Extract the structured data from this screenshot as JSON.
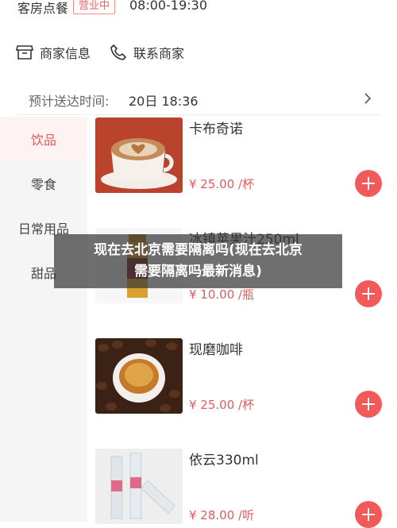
{
  "header": {
    "shop_type": "客房点餐",
    "status_badge": "营业中",
    "hours": "08:00-19:30"
  },
  "actions": {
    "merchant_info": "商家信息",
    "contact_merchant": "联系商家"
  },
  "delivery": {
    "label": "预计送达时间:",
    "time": "20日 18:36"
  },
  "categories": [
    {
      "label": "饮品",
      "active": true
    },
    {
      "label": "零食",
      "active": false
    },
    {
      "label": "日常用品",
      "active": false
    },
    {
      "label": "甜品",
      "active": false
    }
  ],
  "products": [
    {
      "name": "卡布奇诺",
      "price": "¥ 25.00 /杯"
    },
    {
      "name": "冰镇苹果汁250ml",
      "price": "¥ 10.00 /瓶"
    },
    {
      "name": "现磨咖啡",
      "price": "¥ 25.00 /杯"
    },
    {
      "name": "依云330ml",
      "price": "¥ 28.00 /听"
    }
  ],
  "overlay": {
    "line1": "现在去北京需要隔离吗(现在去北京",
    "line2": "需要隔离吗最新消息)"
  },
  "colors": {
    "accent": "#f25a5a",
    "price": "#e05b5b",
    "sidebar_bg": "#f5f5f5"
  }
}
